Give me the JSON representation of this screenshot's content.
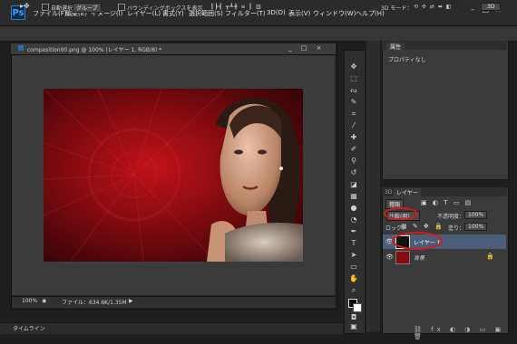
{
  "app": {
    "logo": "Ps"
  },
  "menu": [
    "ファイル(F)",
    "編集(E)",
    "イメージ(I)",
    "レイヤー(L)",
    "書式(Y)",
    "選択範囲(S)",
    "フィルター(T)",
    "3D(D)",
    "表示(V)",
    "ウィンドウ(W)",
    "ヘルプ(H)"
  ],
  "options": {
    "auto_select": "自動選択：",
    "group": "グループ",
    "bbox": "バウンディングボックスを表示",
    "mode3d": "3D モード：",
    "workspace": "3D"
  },
  "document": {
    "title": "composition00.png @ 100% (レイヤー 1, RGB/8) *",
    "zoom": "100%",
    "file_info": "ファイル：634.6K/1.35M"
  },
  "properties": {
    "tab": "属性",
    "no_props": "プロパティなし"
  },
  "layers": {
    "tab_3d": "3D",
    "tab_layers": "レイヤー",
    "kind": "種類",
    "blend": "比較(明)",
    "opacity_label": "不透明度：",
    "opacity": "100%",
    "lock_label": "ロック：",
    "fill_label": "塗り：",
    "fill": "100%",
    "items": [
      {
        "name": "レイヤー 1"
      },
      {
        "name": "背景"
      }
    ]
  },
  "timeline": {
    "label": "タイムライン"
  },
  "colors": {
    "accent_red": "#d41a1a",
    "selected_layer": "#4b5e78"
  }
}
